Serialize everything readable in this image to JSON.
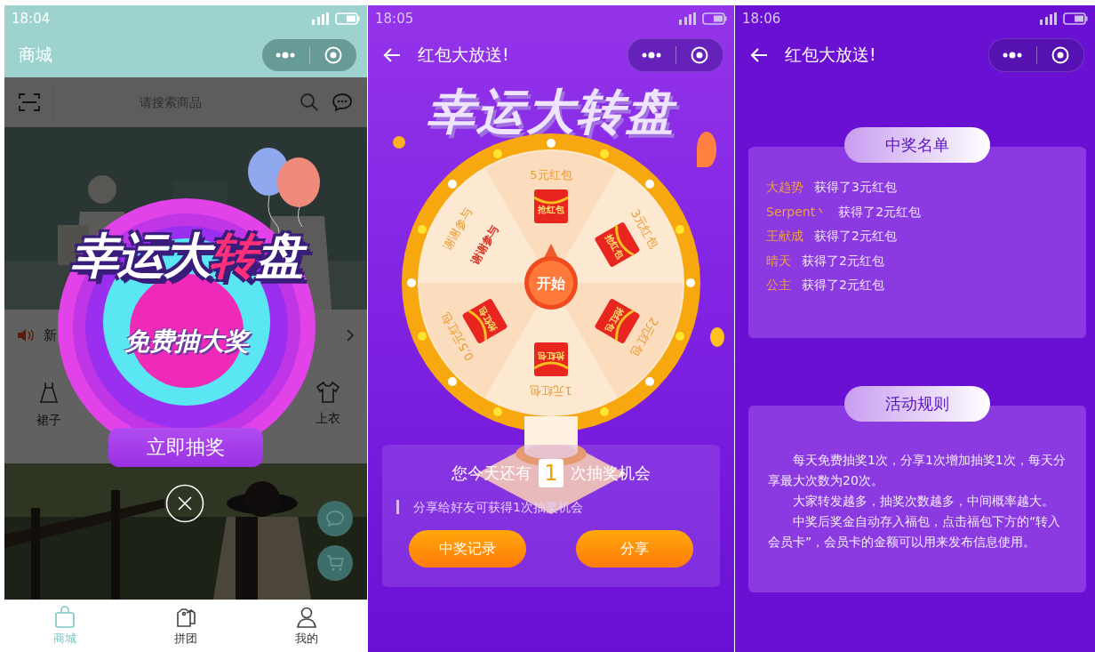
{
  "shop_screen": {
    "status_bar": {
      "time": "18:04"
    },
    "title": "商城",
    "search": {
      "placeholder": "请搜索商品"
    },
    "notice": {
      "text": "新"
    },
    "categories": [
      {
        "label": "裙子",
        "kind": "dress"
      },
      {
        "label": "上衣",
        "kind": "shirt"
      }
    ],
    "popup": {
      "title": [
        {
          "text": "幸运大",
          "accent": false
        },
        {
          "text": "转",
          "accent": true
        },
        {
          "text": "盘",
          "accent": false
        }
      ],
      "subtitle": "免费抽大奖",
      "button": "立即抽奖"
    },
    "tab_bar": [
      {
        "label": "商城",
        "kind": "bag",
        "selected": true
      },
      {
        "label": "拼团",
        "kind": "tag",
        "selected": false
      },
      {
        "label": "我的",
        "kind": "person",
        "selected": false
      }
    ]
  },
  "wheel_screen": {
    "status_bar": {
      "time": "18:05"
    },
    "title": "红包大放送!",
    "title_art": "幸运大转盘",
    "wheel": {
      "start_button": "开始",
      "segments": [
        {
          "label": "5元红包",
          "kind": "prize",
          "envelope": "抢红包"
        },
        {
          "label": "3元红包",
          "kind": "prize",
          "envelope": "抢红包"
        },
        {
          "label": "2元红包",
          "kind": "prize",
          "envelope": "抢红包"
        },
        {
          "label": "1元红包",
          "kind": "prize",
          "envelope": "抢红包"
        },
        {
          "label": "0.5元红包",
          "kind": "prize",
          "envelope": "抢红包"
        },
        {
          "label": "谢谢参与",
          "kind": "blank",
          "note": "谢谢参与"
        }
      ]
    },
    "chances": {
      "before": "您今天还有",
      "count": "1",
      "after": "次抽奖机会"
    },
    "hint": "分享给好友可获得1次抽奖机会",
    "buttons": [
      "中奖记录",
      "分享"
    ]
  },
  "winners_screen": {
    "status_bar": {
      "time": "18:06"
    },
    "title": "红包大放送!",
    "winners": {
      "heading": "中奖名单",
      "rows": [
        {
          "name": "大趋势",
          "text": "获得了3元红包"
        },
        {
          "name": "Serpent丶",
          "text": "获得了2元红包"
        },
        {
          "name": "王献成",
          "text": "获得了2元红包"
        },
        {
          "name": "晴天",
          "text": "获得了2元红包"
        },
        {
          "name": "公主",
          "text": "获得了2元红包"
        }
      ]
    },
    "rules": {
      "heading": "活动规则",
      "paragraphs": [
        "每天免费抽奖1次，分享1次增加抽奖1次，每天分享最大次数为20次。",
        "大家转发越多，抽奖次数越多，中间概率越大。",
        "中奖后奖金自动存入福包，点击福包下方的“转入会员卡”，会员卡的金额可以用来发布信息使用。"
      ]
    }
  }
}
